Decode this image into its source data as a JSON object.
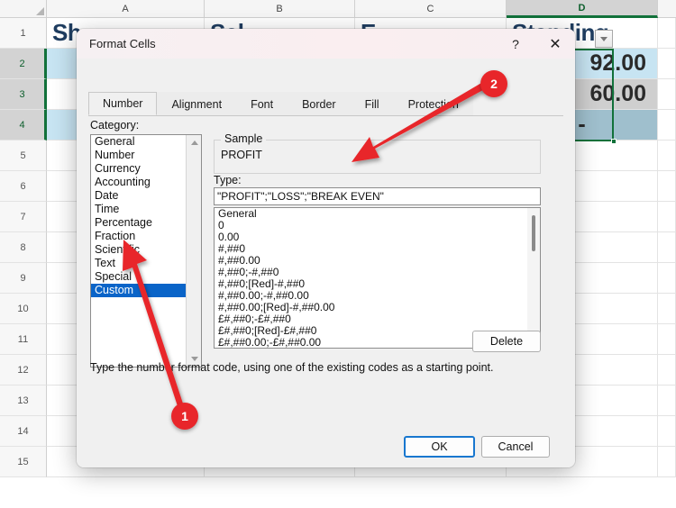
{
  "spreadsheet": {
    "columns": [
      "A",
      "B",
      "C",
      "D"
    ],
    "selected_column": "D",
    "rows": [
      "1",
      "2",
      "3",
      "4",
      "5",
      "6",
      "7",
      "8",
      "9",
      "10",
      "11",
      "12",
      "13",
      "14",
      "15"
    ],
    "selected_rows": [
      "2",
      "3",
      "4"
    ],
    "headers": {
      "a": "Sh",
      "b": "Sal",
      "c": "E",
      "d": "Standing"
    },
    "cells": {
      "d2": "92.00",
      "d3": "60.00",
      "d4": "-"
    },
    "filter_icon": "filter-dropdown-icon"
  },
  "dialog": {
    "title": "Format Cells",
    "help_icon": "?",
    "close_icon": "✕",
    "tabs": [
      {
        "label": "Number",
        "active": true
      },
      {
        "label": "Alignment",
        "active": false
      },
      {
        "label": "Font",
        "active": false
      },
      {
        "label": "Border",
        "active": false
      },
      {
        "label": "Fill",
        "active": false
      },
      {
        "label": "Protection",
        "active": false
      }
    ],
    "category": {
      "label": "Category:",
      "items": [
        "General",
        "Number",
        "Currency",
        "Accounting",
        "Date",
        "Time",
        "Percentage",
        "Fraction",
        "Scientific",
        "Text",
        "Special",
        "Custom"
      ],
      "selected": "Custom",
      "scroll_up_icon": "chevron-up-icon",
      "scroll_down_icon": "chevron-down-icon"
    },
    "sample": {
      "caption": "Sample",
      "value": "PROFIT"
    },
    "type": {
      "label": "Type:",
      "value": "\"PROFIT\";\"LOSS\";\"BREAK EVEN\"",
      "placeholder": ""
    },
    "format_codes": [
      "General",
      "0",
      "0.00",
      "#,##0",
      "#,##0.00",
      "#,##0;-#,##0",
      "#,##0;[Red]-#,##0",
      "#,##0.00;-#,##0.00",
      "#,##0.00;[Red]-#,##0.00",
      "£#,##0;-£#,##0",
      "£#,##0;[Red]-£#,##0",
      "£#,##0.00;-£#,##0.00"
    ],
    "delete_button": "Delete",
    "hint": "Type the number format code, using one of the existing codes as a starting point.",
    "ok_button": "OK",
    "cancel_button": "Cancel"
  },
  "annotations": [
    {
      "number": "1",
      "target": "category-custom-item"
    },
    {
      "number": "2",
      "target": "type-input"
    }
  ],
  "colors": {
    "accent_red": "#e8262a",
    "selection_blue": "#0a64c8",
    "excel_green": "#11713a",
    "focus_blue": "#1877cf"
  }
}
